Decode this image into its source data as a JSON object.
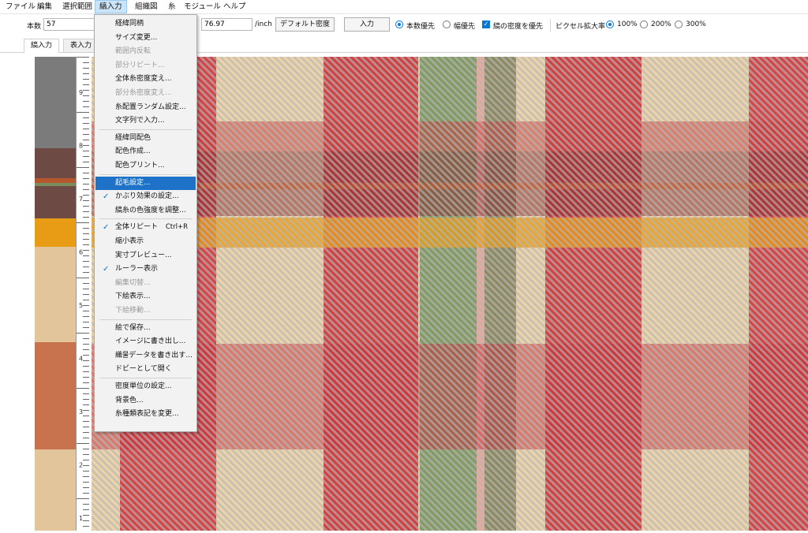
{
  "menubar": [
    "ファイル",
    "編集",
    "選択範囲",
    "縞入力",
    "組織図",
    "糸",
    "モジュール",
    "ヘルプ"
  ],
  "toolbar": {
    "count_label": "本数",
    "count_value": "57",
    "density_value": "76.97",
    "unit": "/inch",
    "default_density_btn": "デフォルト密度",
    "input_btn": "入力",
    "opt_count_priority": "本数優先",
    "opt_width_priority": "幅優先",
    "opt_stripe_density_priority": "縞の密度を優先",
    "zoom_label": "ピクセル拡大率",
    "zoom_100": "100%",
    "zoom_200": "200%",
    "zoom_300": "300%"
  },
  "tabs": [
    "縞入力",
    "表入力"
  ],
  "menu": {
    "items": [
      {
        "label": "経緯同柄",
        "checked": false,
        "disabled": false,
        "shortcut": ""
      },
      {
        "label": "サイズ変更...",
        "checked": false,
        "disabled": false,
        "shortcut": ""
      },
      {
        "label": "範囲内反転",
        "checked": false,
        "disabled": true,
        "shortcut": ""
      },
      {
        "label": "部分リピート...",
        "checked": false,
        "disabled": true,
        "shortcut": ""
      },
      {
        "label": "全体糸密度変え...",
        "checked": false,
        "disabled": false,
        "shortcut": ""
      },
      {
        "label": "部分糸密度変え...",
        "checked": false,
        "disabled": true,
        "shortcut": ""
      },
      {
        "label": "糸配置ランダム設定...",
        "checked": false,
        "disabled": false,
        "shortcut": ""
      },
      {
        "label": "文字列で入力...",
        "checked": false,
        "disabled": false,
        "shortcut": ""
      },
      {
        "label": "経緯同配色",
        "checked": false,
        "disabled": false,
        "shortcut": ""
      },
      {
        "label": "配色作成...",
        "checked": false,
        "disabled": false,
        "shortcut": ""
      },
      {
        "label": "配色プリント...",
        "checked": false,
        "disabled": false,
        "shortcut": ""
      },
      {
        "label": "起毛設定...",
        "checked": false,
        "disabled": false,
        "shortcut": "",
        "highlight": true
      },
      {
        "label": "かぶり効果の設定...",
        "checked": true,
        "disabled": false,
        "shortcut": ""
      },
      {
        "label": "縞糸の色強度を調整...",
        "checked": false,
        "disabled": false,
        "shortcut": ""
      },
      {
        "label": "全体リピート",
        "checked": true,
        "disabled": false,
        "shortcut": "Ctrl+R"
      },
      {
        "label": "縮小表示",
        "checked": false,
        "disabled": false,
        "shortcut": ""
      },
      {
        "label": "実寸プレビュー...",
        "checked": false,
        "disabled": false,
        "shortcut": ""
      },
      {
        "label": "ルーラー表示",
        "checked": true,
        "disabled": false,
        "shortcut": ""
      },
      {
        "label": "編集切替...",
        "checked": false,
        "disabled": true,
        "shortcut": ""
      },
      {
        "label": "下絵表示...",
        "checked": false,
        "disabled": false,
        "shortcut": ""
      },
      {
        "label": "下絵移動...",
        "checked": false,
        "disabled": true,
        "shortcut": ""
      },
      {
        "label": "絵で保存...",
        "checked": false,
        "disabled": false,
        "shortcut": ""
      },
      {
        "label": "イメージに書き出し...",
        "checked": false,
        "disabled": false,
        "shortcut": ""
      },
      {
        "label": "織물データを書き出す...",
        "checked": false,
        "disabled": false,
        "shortcut": ""
      },
      {
        "label": "ドビーとして開く",
        "checked": false,
        "disabled": false,
        "shortcut": ""
      },
      {
        "label": "密度単位の設定...",
        "checked": false,
        "disabled": false,
        "shortcut": ""
      },
      {
        "label": "背景色...",
        "checked": false,
        "disabled": false,
        "shortcut": ""
      },
      {
        "label": "糸種類表記を変更...",
        "checked": false,
        "disabled": false,
        "shortcut": ""
      }
    ]
  },
  "ruler_labels": [
    "9",
    "8",
    "7",
    "6",
    "5",
    "4",
    "3",
    "2",
    "1"
  ],
  "colors": {
    "accent": "#0078d7",
    "menu_highlight": "#1e73c8",
    "beige": "#ecd3a9",
    "red": "#c8303a",
    "dark_red": "#8a2a2c",
    "green": "#6f8f55",
    "orange": "#e89b14",
    "pink": "#e8a89a",
    "gray": "#7b7b7b",
    "brown": "#6e4a44",
    "terracotta": "#c8734e"
  }
}
